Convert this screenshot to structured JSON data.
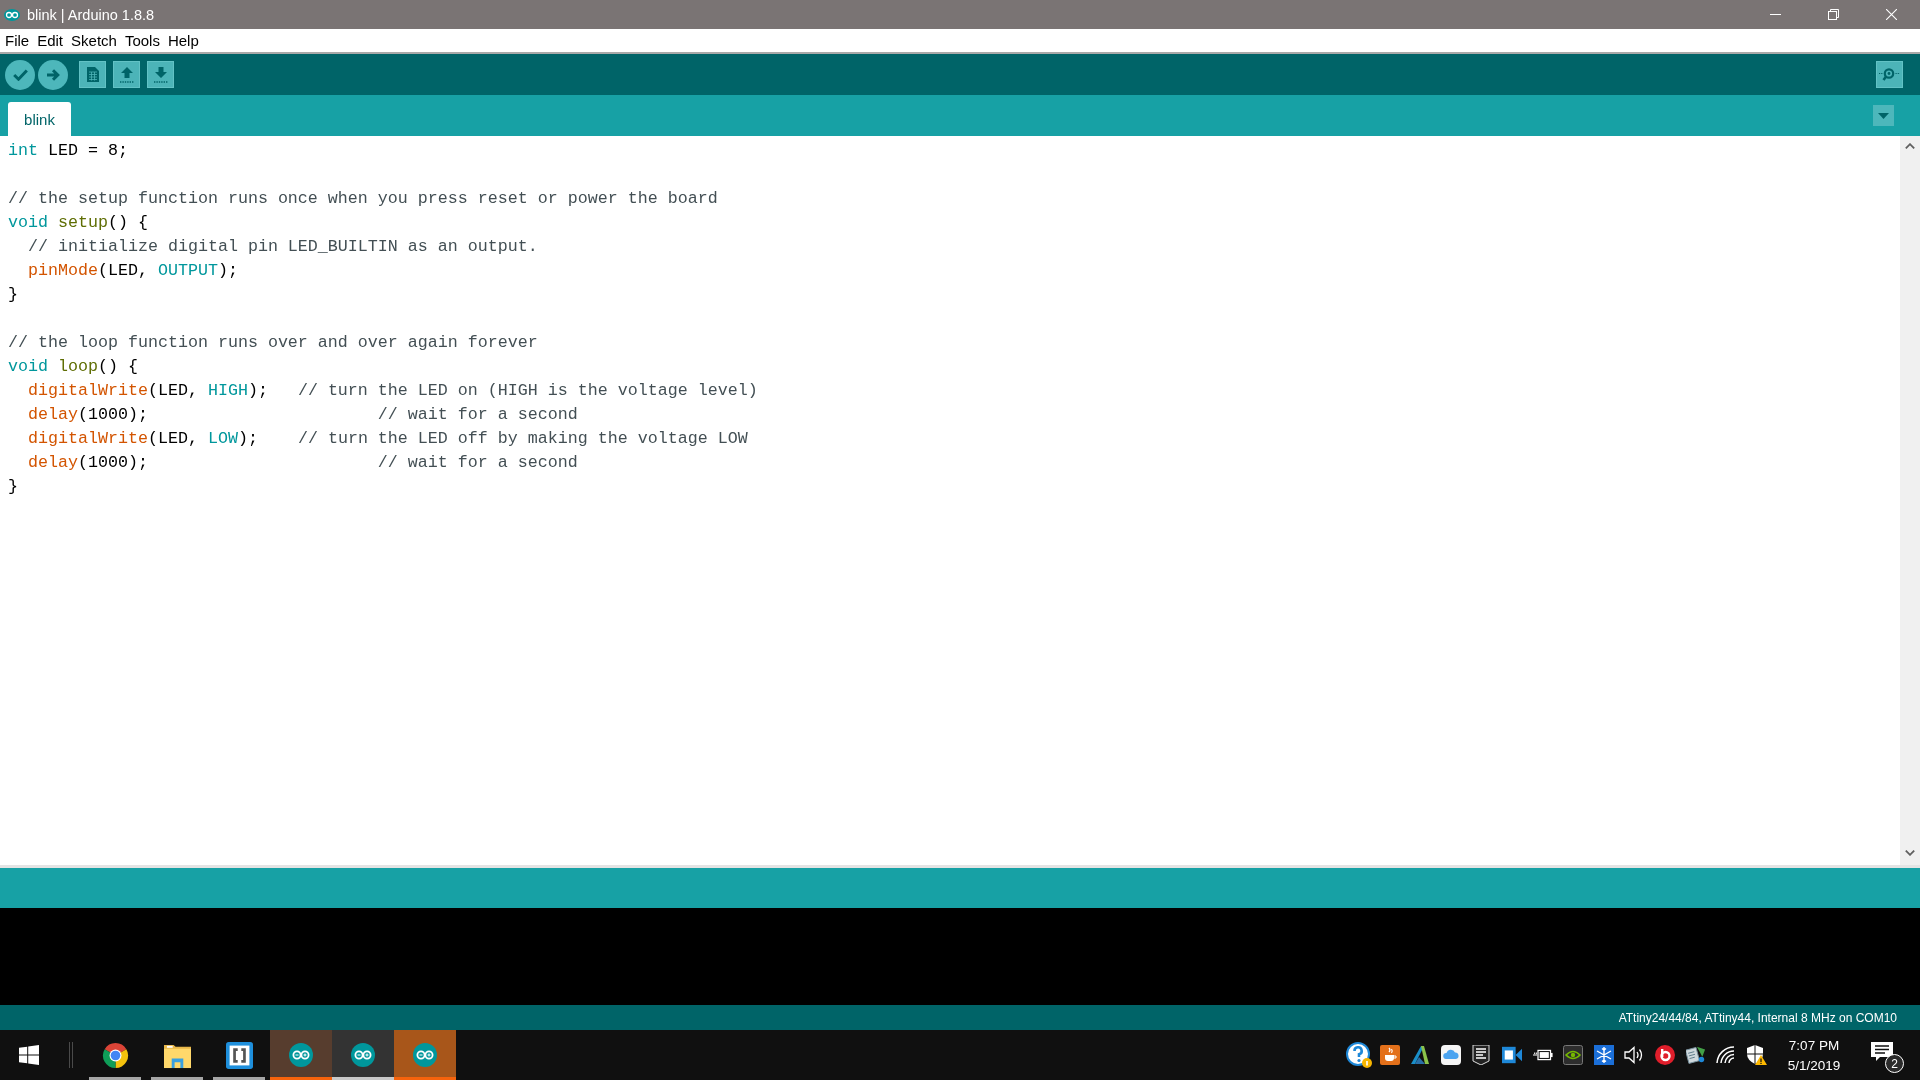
{
  "window": {
    "title": "blink | Arduino 1.8.8"
  },
  "menu": [
    "File",
    "Edit",
    "Sketch",
    "Tools",
    "Help"
  ],
  "tabs": [
    {
      "label": "blink",
      "selected": true
    }
  ],
  "editor": {
    "blocks": [
      {
        "lines": [
          {
            "tokens": [
              {
                "kind": "type",
                "text": "int"
              },
              {
                "kind": "plain",
                "text": " LED = 8;"
              }
            ]
          }
        ]
      },
      {
        "lines": [
          {
            "tokens": [
              {
                "kind": "comment",
                "text": "// the setup function runs once when you press reset or power the board"
              }
            ]
          },
          {
            "tokens": [
              {
                "kind": "type",
                "text": "void"
              },
              {
                "kind": "declaration",
                "text": " setup"
              },
              {
                "kind": "plain",
                "text": "() {"
              }
            ]
          },
          {
            "tokens": [
              {
                "kind": "comment",
                "text": "  // initialize digital pin LED_BUILTIN as an output."
              }
            ]
          },
          {
            "tokens": [
              {
                "kind": "function",
                "text": "  pinMode"
              },
              {
                "kind": "plain",
                "text": "(LED, "
              },
              {
                "kind": "constant",
                "text": "OUTPUT"
              },
              {
                "kind": "plain",
                "text": ");"
              }
            ]
          },
          {
            "tokens": [
              {
                "kind": "plain",
                "text": "}"
              }
            ]
          }
        ]
      },
      {
        "lines": [
          {
            "tokens": [
              {
                "kind": "comment",
                "text": "// the loop function runs over and over again forever"
              }
            ]
          },
          {
            "tokens": [
              {
                "kind": "type",
                "text": "void"
              },
              {
                "kind": "declaration",
                "text": " loop"
              },
              {
                "kind": "plain",
                "text": "() {"
              }
            ]
          },
          {
            "tokens": [
              {
                "kind": "function",
                "text": "  digitalWrite"
              },
              {
                "kind": "plain",
                "text": "(LED, "
              },
              {
                "kind": "constant",
                "text": "HIGH"
              },
              {
                "kind": "plain",
                "text": ");   "
              },
              {
                "kind": "comment",
                "text": "// turn the LED on (HIGH is the voltage level)"
              }
            ]
          },
          {
            "tokens": [
              {
                "kind": "function",
                "text": "  delay"
              },
              {
                "kind": "plain",
                "text": "(1000);                       "
              },
              {
                "kind": "comment",
                "text": "// wait for a second"
              }
            ]
          },
          {
            "tokens": [
              {
                "kind": "function",
                "text": "  digitalWrite"
              },
              {
                "kind": "plain",
                "text": "(LED, "
              },
              {
                "kind": "constant",
                "text": "LOW"
              },
              {
                "kind": "plain",
                "text": ");    "
              },
              {
                "kind": "comment",
                "text": "// turn the LED off by making the voltage LOW"
              }
            ]
          },
          {
            "tokens": [
              {
                "kind": "function",
                "text": "  delay"
              },
              {
                "kind": "plain",
                "text": "(1000);                       "
              },
              {
                "kind": "comment",
                "text": "// wait for a second"
              }
            ]
          },
          {
            "tokens": [
              {
                "kind": "plain",
                "text": "}"
              }
            ]
          }
        ]
      }
    ]
  },
  "status_bar": {
    "board": "ATtiny24/44/84, ATtiny44, Internal 8 MHz on COM10"
  },
  "taskbar": {
    "apps": [
      {
        "kind": "browser",
        "running": true,
        "active": false,
        "attention": false
      },
      {
        "kind": "folder",
        "running": true,
        "active": false,
        "attention": false
      },
      {
        "kind": "brackets",
        "running": true,
        "active": false,
        "attention": false
      },
      {
        "kind": "arduino",
        "running": true,
        "active": false,
        "attention": true,
        "color": "#573d2e"
      },
      {
        "kind": "arduino",
        "running": true,
        "active": true,
        "attention": false
      },
      {
        "kind": "arduino",
        "running": true,
        "active": false,
        "attention": true,
        "color": "#a8561a"
      }
    ],
    "clock": {
      "time": "7:07 PM",
      "date": "5/1/2019"
    },
    "notification_count": "2"
  }
}
